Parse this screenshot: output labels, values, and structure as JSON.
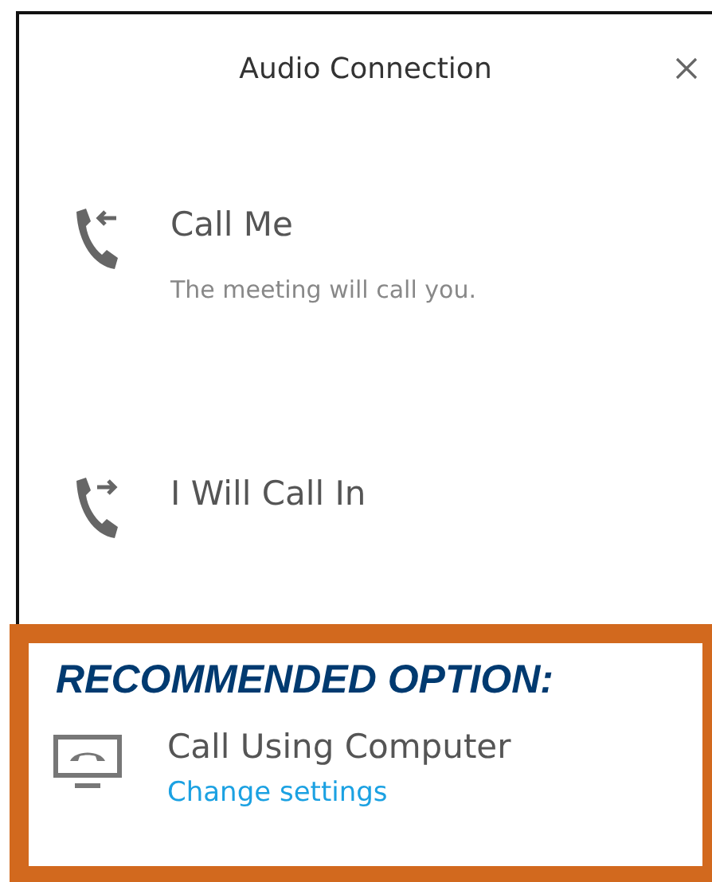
{
  "dialog": {
    "title": "Audio Connection",
    "options": [
      {
        "kind": "incoming",
        "label": "Call Me",
        "description": "The meeting will call you."
      },
      {
        "kind": "outgoing",
        "label": "I Will Call In"
      }
    ]
  },
  "recommended": {
    "heading": "RECOMMENDED OPTION:",
    "option": {
      "kind": "computer",
      "label": "Call Using Computer",
      "link": "Change settings"
    }
  }
}
